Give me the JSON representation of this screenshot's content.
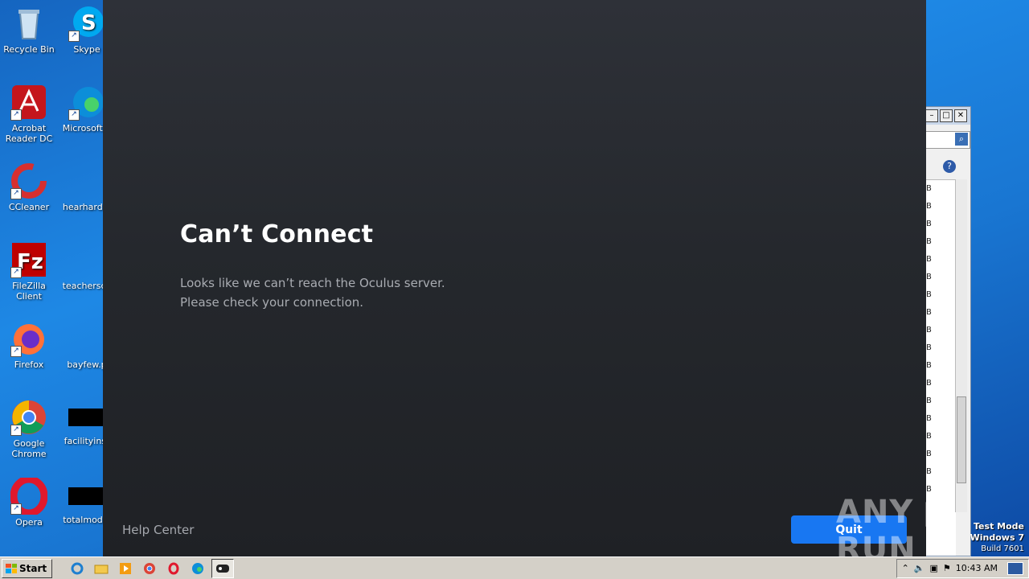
{
  "desktop": {
    "icons": [
      {
        "label": "Recycle Bin",
        "icon": "recycle-bin-icon"
      },
      {
        "label": "Skype",
        "icon": "skype-icon"
      },
      {
        "label": "Acrobat Reader DC",
        "icon": "acrobat-icon"
      },
      {
        "label": "Microsoft E",
        "icon": "edge-icon"
      },
      {
        "label": "CCleaner",
        "icon": "ccleaner-icon"
      },
      {
        "label": "hearhard.p",
        "icon": "file-icon"
      },
      {
        "label": "FileZilla Client",
        "icon": "filezilla-icon"
      },
      {
        "label": "teachersco",
        "icon": "file-icon"
      },
      {
        "label": "Firefox",
        "icon": "firefox-icon"
      },
      {
        "label": "bayfew.p",
        "icon": "file-icon"
      },
      {
        "label": "Google Chrome",
        "icon": "chrome-icon"
      },
      {
        "label": "facilityinst",
        "icon": "file-icon"
      },
      {
        "label": "Opera",
        "icon": "opera-icon"
      },
      {
        "label": "totalmodifi",
        "icon": "file-icon"
      }
    ]
  },
  "app": {
    "title": "Can’t Connect",
    "message": "Looks like we can’t reach the Oculus server. Please check your connection.",
    "help_link": "Help Center",
    "quit_label": "Quit",
    "accent": "#1877f2"
  },
  "watermark": {
    "brand": "ANY ▷ RUN",
    "test_mode": "Test Mode",
    "os": "Windows 7",
    "build": "Build 7601"
  },
  "taskbar": {
    "start_label": "Start",
    "clock": "10:43 AM"
  }
}
